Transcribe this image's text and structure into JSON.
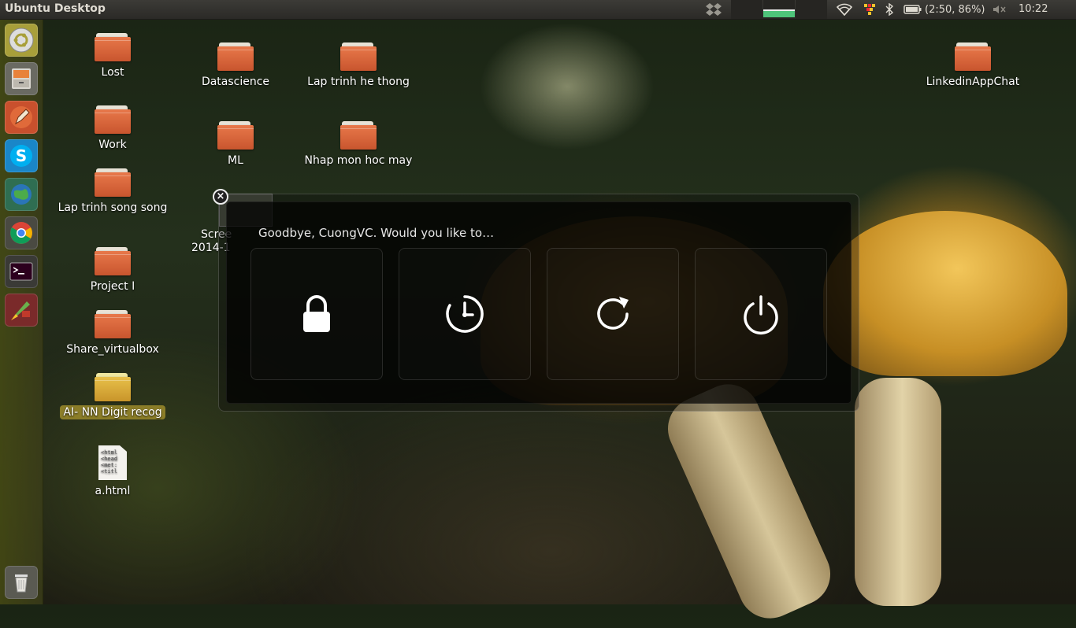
{
  "top_panel": {
    "title": "Ubuntu Desktop",
    "battery_text": "(2:50, 86%)",
    "clock": "10:22",
    "icons": [
      "dropbox-icon",
      "system-monitor-icon",
      "wifi-icon",
      "keyboard-layout-icon",
      "bluetooth-icon",
      "battery-icon",
      "volume-muted-icon"
    ]
  },
  "launcher": {
    "items": [
      "dash-home",
      "files",
      "text-editor",
      "skype",
      "network-browser",
      "chrome",
      "terminal",
      "paint",
      "trash"
    ]
  },
  "desktop": {
    "icons": [
      {
        "label": "Lost",
        "type": "folder"
      },
      {
        "label": "Work",
        "type": "folder"
      },
      {
        "label": "Lap trinh song song",
        "type": "folder"
      },
      {
        "label": "Project I",
        "type": "folder"
      },
      {
        "label": "Share_virtualbox",
        "type": "folder"
      },
      {
        "label": "AI- NN Digit recog",
        "type": "folder",
        "selected": true
      },
      {
        "label": "a.html",
        "type": "file"
      },
      {
        "label": "Datascience",
        "type": "folder"
      },
      {
        "label": "ML",
        "type": "folder"
      },
      {
        "label": "Lap trinh he thong",
        "type": "folder"
      },
      {
        "label": "Nhap mon hoc may",
        "type": "folder"
      },
      {
        "label": "LinkedinAppChat",
        "type": "folder"
      }
    ],
    "screenshot_label_line1": "Scree",
    "screenshot_label_line2": "2014-1",
    "html_preview": "<html\n<head\n<met:\n<titl"
  },
  "logout_dialog": {
    "message": "Goodbye, CuongVC. Would you like to…",
    "actions": [
      "lock",
      "suspend",
      "restart",
      "shutdown"
    ]
  },
  "colors": {
    "panel": "#3c3b37",
    "launcher_tint": "#464b14",
    "folder": "#d9623a",
    "selection": "#8b7d28"
  }
}
